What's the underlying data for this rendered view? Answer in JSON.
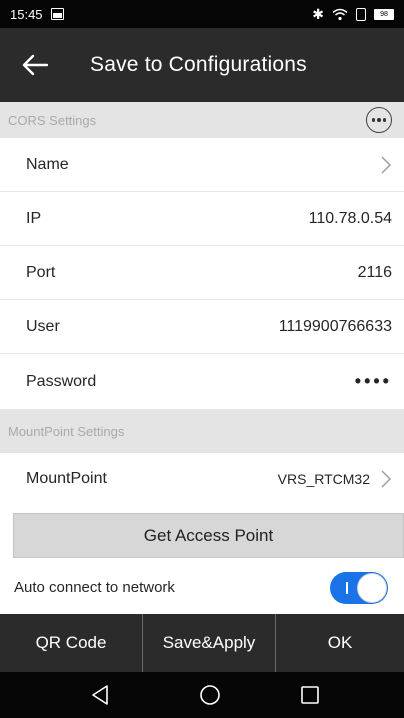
{
  "status_bar": {
    "time": "15:45",
    "battery": "98"
  },
  "app_bar": {
    "title": "Save to Configurations",
    "back_icon": "arrow-left-icon"
  },
  "cors_section": {
    "header": "CORS Settings",
    "more_icon": "more-horizontal-circle-icon",
    "rows": {
      "name": {
        "label": "Name",
        "value": ""
      },
      "ip": {
        "label": "IP",
        "value": "110.78.0.54"
      },
      "port": {
        "label": "Port",
        "value": "2116"
      },
      "user": {
        "label": "User",
        "value": "1119900766633"
      },
      "password": {
        "label": "Password",
        "value": "••••"
      }
    }
  },
  "mountpoint_section": {
    "header": "MountPoint Settings",
    "mountpoint": {
      "label": "MountPoint",
      "value": "VRS_RTCM32"
    }
  },
  "access_point_button": "Get Access Point",
  "auto_connect": {
    "label": "Auto connect to network",
    "enabled": true,
    "toggle_color": "#1a73e8"
  },
  "bottom_bar": {
    "qr_code": "QR Code",
    "save_apply": "Save&Apply",
    "ok": "OK"
  },
  "colors": {
    "app_bar_bg": "#2b2b2b",
    "section_bg": "#e4e4e4",
    "accent": "#1a73e8"
  }
}
